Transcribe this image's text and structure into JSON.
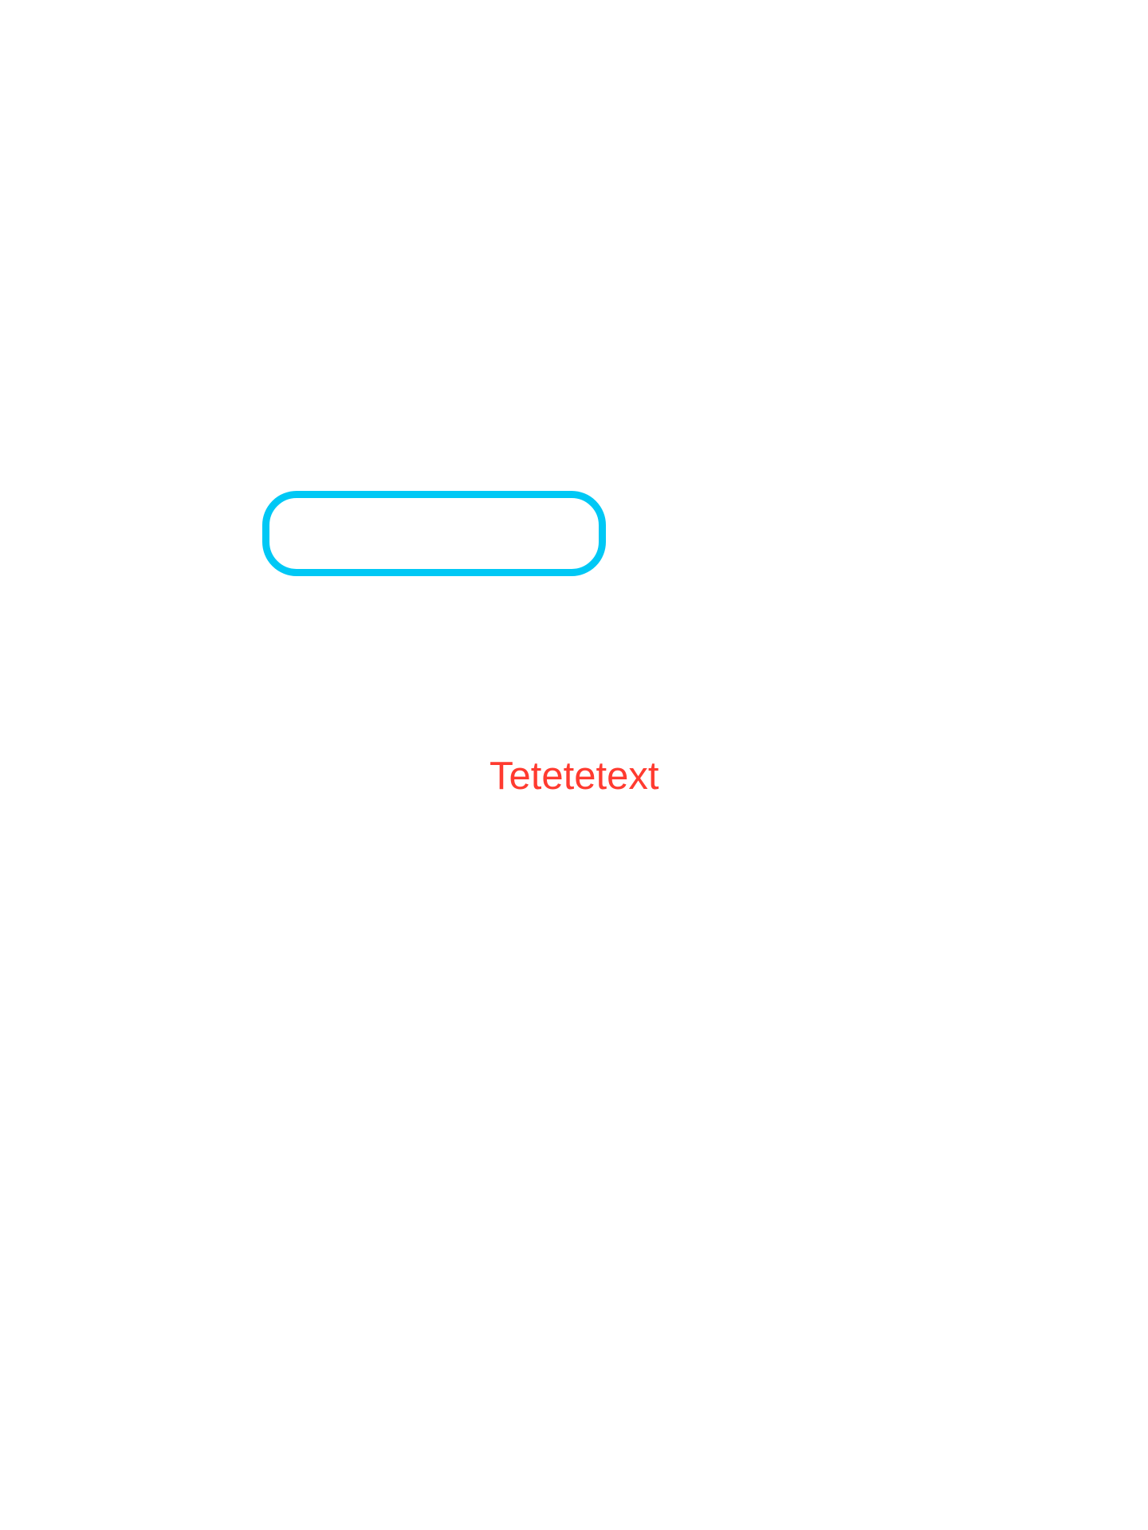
{
  "colors": {
    "background": "#ffffff",
    "field_border": "#00c8f5",
    "label_text": "#ff3b30"
  },
  "field": {
    "value": ""
  },
  "label": {
    "text": "Tetetetext"
  }
}
